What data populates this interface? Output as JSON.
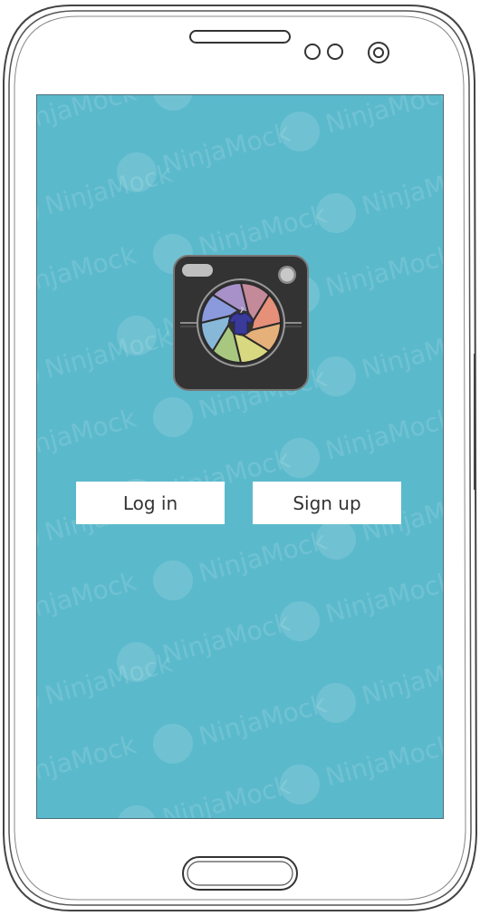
{
  "screen": {
    "background_color": "#5bb9cc",
    "watermark_text": "NinjaMock"
  },
  "logo": {
    "icon": "camera-aperture-icon",
    "shirt_icon": "t-shirt-icon",
    "body_color": "#333333",
    "aperture_colors": [
      "#c48a9a",
      "#e6907a",
      "#e6b07a",
      "#d8d880",
      "#a8c880",
      "#88b8d8",
      "#8a9adc",
      "#a890c8"
    ]
  },
  "actions": {
    "login_label": "Log in",
    "signup_label": "Sign up"
  }
}
